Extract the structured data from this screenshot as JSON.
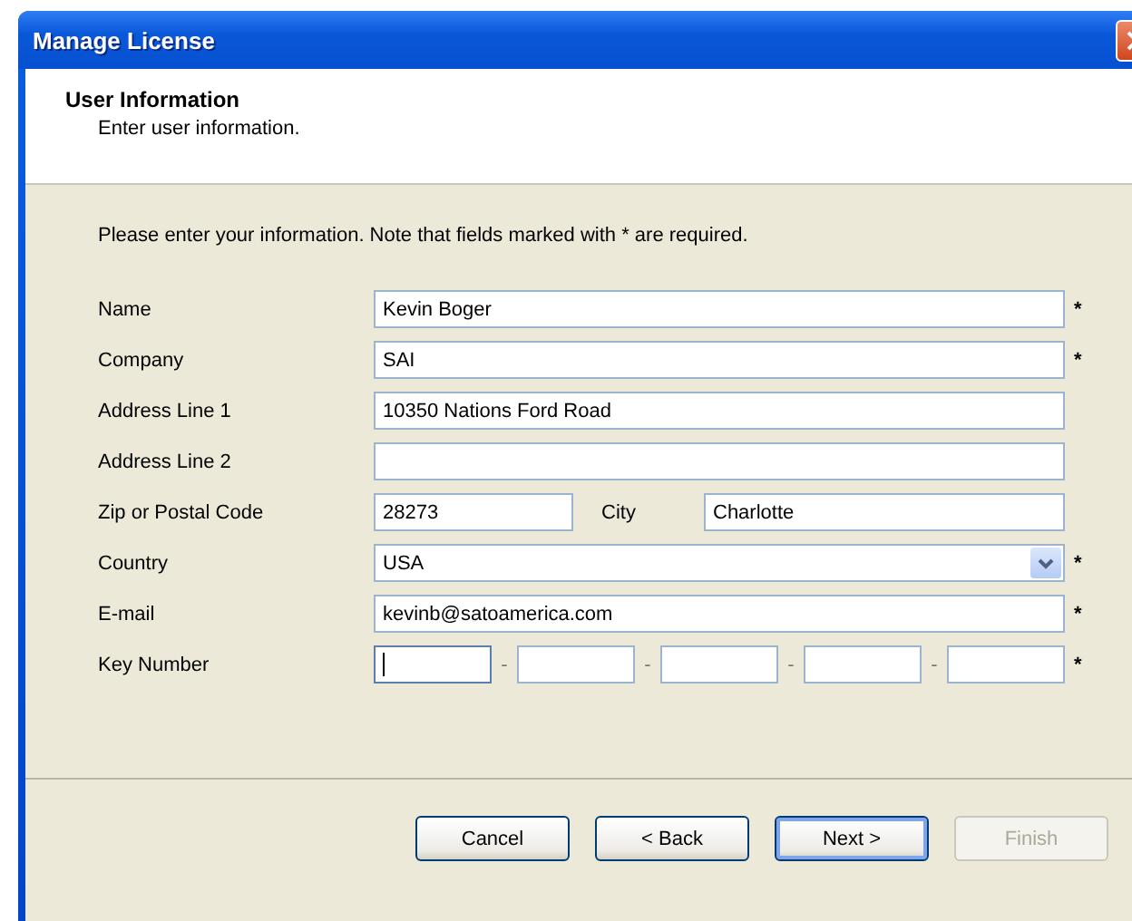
{
  "window": {
    "title": "Manage License"
  },
  "header": {
    "title": "User Information",
    "subtitle": "Enter user information."
  },
  "instructions": "Please enter your information. Note that fields marked with * are required.",
  "form": [
    {
      "kind": "text",
      "label": "Name",
      "value": "Kevin Boger",
      "required_mark": "*"
    },
    {
      "kind": "text",
      "label": "Company",
      "value": "SAI",
      "required_mark": "*"
    },
    {
      "kind": "text",
      "label": "Address Line 1",
      "value": "10350 Nations Ford Road"
    },
    {
      "kind": "text",
      "label": "Address Line 2"
    },
    {
      "kind": "zip-city",
      "label": "Zip or Postal Code",
      "value": "28273",
      "second_label": "City",
      "second_value": "Charlotte"
    },
    {
      "kind": "select",
      "label": "Country",
      "value": "USA",
      "required_mark": "*"
    },
    {
      "kind": "text",
      "label": "E-mail",
      "value": "kevinb@satoamerica.com",
      "required_mark": "*"
    },
    {
      "kind": "key",
      "label": "Key Number",
      "separator": "-",
      "required_mark": "*",
      "segments": [
        {
          "focused": true
        },
        {
          "focused": false
        },
        {
          "focused": false
        },
        {
          "focused": false
        },
        {
          "focused": false
        }
      ]
    }
  ],
  "buttons": [
    {
      "label": "Cancel",
      "default": false,
      "disabled": false
    },
    {
      "label": "< Back",
      "default": false,
      "disabled": false
    },
    {
      "label": "Next >",
      "default": true,
      "disabled": false
    },
    {
      "label": "Finish",
      "default": false,
      "disabled": true
    }
  ]
}
